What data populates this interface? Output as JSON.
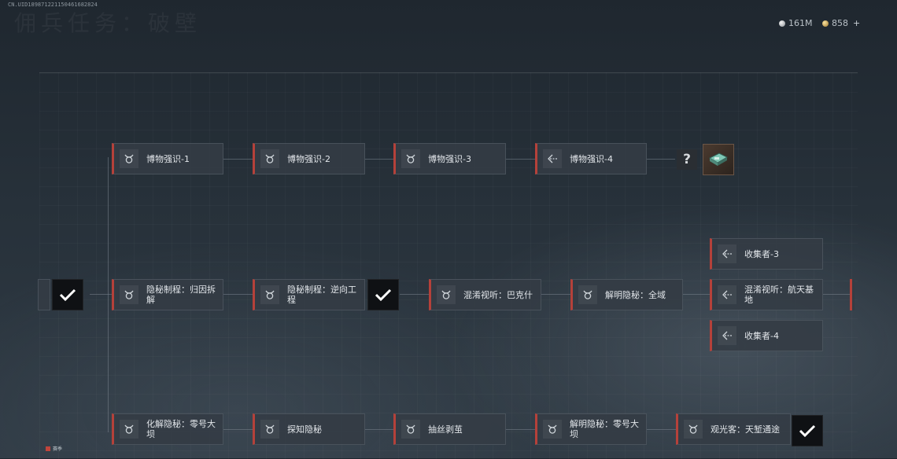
{
  "header": {
    "build_id": "CN.UID189871221150461682824",
    "title": "佣兵任务：破壁"
  },
  "currency": [
    {
      "icon": "silver-coin-icon",
      "value": "161M"
    },
    {
      "icon": "gold-coin-icon",
      "value": "858",
      "add": "+"
    }
  ],
  "rows": {
    "top": [
      "博物强识-1",
      "博物强识-2",
      "博物强识-3",
      "博物强识-4"
    ],
    "mid": [
      "隐秘制程：归因拆解",
      "隐秘制程：逆向工程",
      "混淆视听：巴克什",
      "解明隐秘：全域"
    ],
    "branch": [
      "收集者-3",
      "混淆视听：航天基地",
      "收集者-4"
    ],
    "bottom": [
      "化解隐秘：零号大坝",
      "探知隐秘",
      "抽丝剥茧",
      "解明隐秘：零号大坝",
      "观光客：天堑通途"
    ]
  },
  "unknown_reward": "?",
  "legend": "赛季",
  "colors": {
    "accent": "#b5413a",
    "node_bg": "#343c45",
    "check_bg": "#0f1114"
  }
}
